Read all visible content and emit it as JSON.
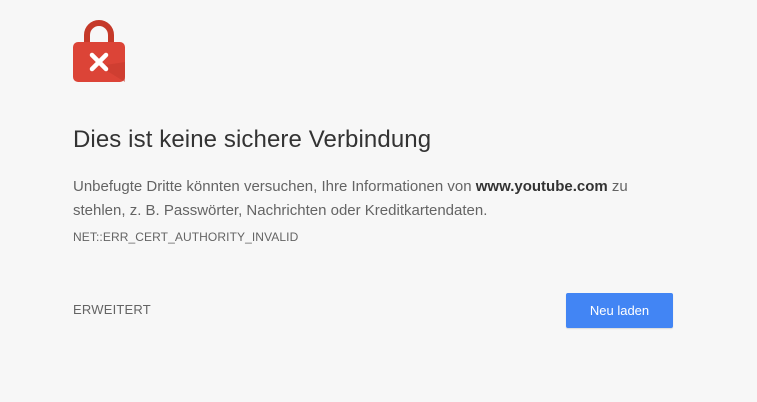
{
  "icon": "lock-error-icon",
  "colors": {
    "background": "#f7f7f7",
    "lock_red": "#d93025",
    "primary_button": "#4285f4"
  },
  "heading": "Dies ist keine sichere Verbindung",
  "explanation": {
    "before_domain": "Unbefugte Dritte könnten versuchen, Ihre Informationen von ",
    "domain": "www.youtube.com",
    "after_domain": " zu stehlen, z. B. Passwörter, Nachrichten oder Kreditkartendaten."
  },
  "error_code": "NET::ERR_CERT_AUTHORITY_INVALID",
  "buttons": {
    "advanced": "ERWEITERT",
    "reload": "Neu laden"
  }
}
